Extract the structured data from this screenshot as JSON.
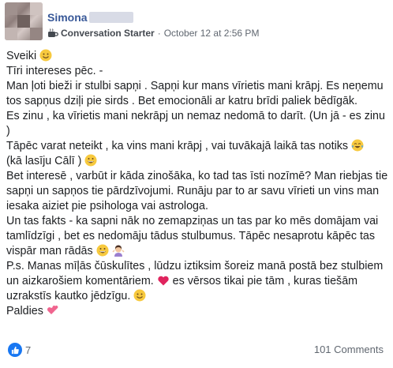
{
  "post": {
    "author": "Simona",
    "badge": "Conversation Starter",
    "timestamp": "October 12 at 2:56 PM",
    "separator": "·",
    "paragraphs": [
      {
        "text": "Sveiki ",
        "emoji": "smile"
      },
      {
        "text": "Tīri intereses pēc. -"
      },
      {
        "text": "Man ļoti bieži ir stulbi sapņi . Sapņi kur mans vīrietis mani krāpj. Es neņemu tos sapņus dziļi pie sirds . Bet emocionāli ar katru brīdi paliek bēdīgāk."
      },
      {
        "text": "Es zinu , ka vīrietis mani nekrāpj un nemaz nedomā to darīt. (Un jā - es zinu )"
      },
      {
        "text": "Tāpēc varat neteikt , ka vins mani krāpj , vai tuvākajā laikā tas notiks ",
        "emoji": "laugh-cry",
        "after": "(kā lasīju Cālī ) ",
        "emoji2": "grin"
      },
      {
        "text": "Bet interesē , varbūt ir kāda zinošāka, ko tad tas īsti nozīmē? Man riebjas tie sapņi un sapņos tie pārdzīvojumi. Runāju par to ar savu vīrieti un vins man iesaka aiziet pie psihologa vai astrologa."
      },
      {
        "text": "Un tas fakts - ka sapni nāk no zemapziņas un tas par ko mēs domājam vai tamlīdzīgi , bet es nedomāju tādus stulbumus. Tāpēc nesaprotu kāpēc tas vispār man rādās ",
        "emoji": "grin",
        "emoji2": "woman-shrug"
      },
      {
        "text": "P.s. Manas mīļās čūskulītes , lūdzu iztiksim šoreiz manā postā bez stulbiem un aizkarošiem komentāriem. ",
        "emoji": "heart",
        "after": " es vērsos tikai pie tām , kuras tiešām uzrakstīs kautko jēdzīgu. ",
        "emoji2": "smile"
      },
      {
        "text": "Paldies ",
        "emoji": "two-hearts"
      }
    ]
  },
  "footer": {
    "like_count": "7",
    "comments": "101 Comments"
  }
}
